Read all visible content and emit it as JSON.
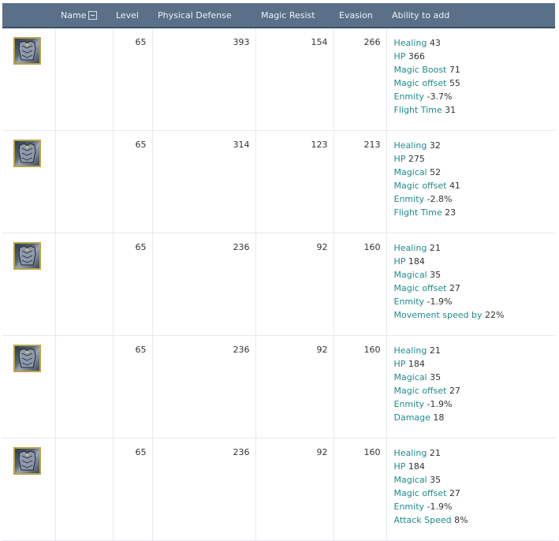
{
  "header": {
    "name_label": "Name",
    "level_label": "Level",
    "pdef_label": "Physical Defense",
    "mres_label": "Magic Resist",
    "evasion_label": "Evasion",
    "ability_label": "Ability to add"
  },
  "rows": [
    {
      "icon": "armor-icon-gold-trim",
      "name": "",
      "level": "65",
      "physical_defense": "393",
      "magic_resist": "154",
      "evasion": "266",
      "abilities": [
        {
          "name": "Healing",
          "value": "43"
        },
        {
          "name": "HP",
          "value": "366"
        },
        {
          "name": "Magic Boost",
          "value": "71"
        },
        {
          "name": "Magic offset",
          "value": "55"
        },
        {
          "name": "Enmity",
          "value": "-3.7%"
        },
        {
          "name": "Flight Time",
          "value": "31"
        }
      ]
    },
    {
      "icon": "armor-icon-blue-plate",
      "name": "",
      "level": "65",
      "physical_defense": "314",
      "magic_resist": "123",
      "evasion": "213",
      "abilities": [
        {
          "name": "Healing",
          "value": "32"
        },
        {
          "name": "HP",
          "value": "275"
        },
        {
          "name": "Magical",
          "value": "52"
        },
        {
          "name": "Magic offset",
          "value": "41"
        },
        {
          "name": "Enmity",
          "value": "-2.8%"
        },
        {
          "name": "Flight Time",
          "value": "23"
        }
      ]
    },
    {
      "icon": "armor-icon-pants",
      "name": "",
      "level": "65",
      "physical_defense": "236",
      "magic_resist": "92",
      "evasion": "160",
      "abilities": [
        {
          "name": "Healing",
          "value": "21"
        },
        {
          "name": "HP",
          "value": "184"
        },
        {
          "name": "Magical",
          "value": "35"
        },
        {
          "name": "Magic offset",
          "value": "27"
        },
        {
          "name": "Enmity",
          "value": "-1.9%"
        },
        {
          "name": "Movement speed by",
          "value": "22%"
        }
      ]
    },
    {
      "icon": "armor-icon-boots",
      "name": "",
      "level": "65",
      "physical_defense": "236",
      "magic_resist": "92",
      "evasion": "160",
      "abilities": [
        {
          "name": "Healing",
          "value": "21"
        },
        {
          "name": "HP",
          "value": "184"
        },
        {
          "name": "Magical",
          "value": "35"
        },
        {
          "name": "Magic offset",
          "value": "27"
        },
        {
          "name": "Enmity",
          "value": "-1.9%"
        },
        {
          "name": "Damage",
          "value": "18"
        }
      ]
    },
    {
      "icon": "armor-icon-shoulders",
      "name": "",
      "level": "65",
      "physical_defense": "236",
      "magic_resist": "92",
      "evasion": "160",
      "abilities": [
        {
          "name": "Healing",
          "value": "21"
        },
        {
          "name": "HP",
          "value": "184"
        },
        {
          "name": "Magical",
          "value": "35"
        },
        {
          "name": "Magic offset",
          "value": "27"
        },
        {
          "name": "Enmity",
          "value": "-1.9%"
        },
        {
          "name": "Attack Speed",
          "value": "8%"
        }
      ]
    }
  ],
  "colors": {
    "header_bg": "#5a6f88",
    "ability_name": "#1f8b8b",
    "grid_line": "#e6e9ee",
    "icon_border": "#b8a44a"
  }
}
